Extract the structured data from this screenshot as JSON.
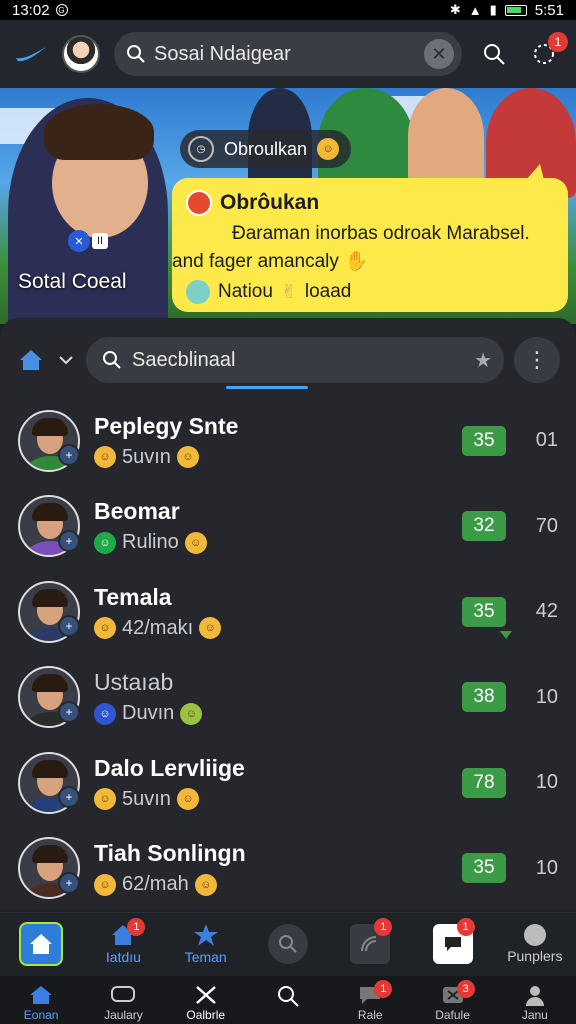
{
  "status_bar": {
    "time": "13:02",
    "battery": "5:51"
  },
  "top_bar": {
    "search_value": "Sosai Ndaigear"
  },
  "hero": {
    "caption": "Sotal Coeal",
    "chip_label": "Obroulkan",
    "badge_text": "II"
  },
  "popup": {
    "title": "Obrôukan",
    "body_line1": "Ðaraman inorbas odroak Marabsel.",
    "body_line2": "and fager amancaly",
    "footer": "Natiou",
    "footer_suffix": "loaad"
  },
  "panel": {
    "search_value": "Saecblinaal",
    "contacts": [
      {
        "name": "Peplegy Snte",
        "sub": "5uvın",
        "score": "35",
        "count": "01",
        "shirt": "#2f8a3a",
        "muted": false
      },
      {
        "name": "Beomar",
        "sub": "Rulino",
        "score": "32",
        "count": "70",
        "shirt": "#7b4fb8",
        "muted": false
      },
      {
        "name": "Temala",
        "sub": "42/makı",
        "score": "35",
        "count": "42",
        "shirt": "#2d3a66",
        "muted": false
      },
      {
        "name": "Ustaıab",
        "sub": "Duvın",
        "score": "38",
        "count": "10",
        "shirt": "#2b2b2b",
        "muted": true
      },
      {
        "name": "Dalo Lervliige",
        "sub": "5uvın",
        "score": "78",
        "count": "10",
        "shirt": "#22407a",
        "muted": false
      },
      {
        "name": "Tiah Sonlingn",
        "sub": "62/mah",
        "score": "35",
        "count": "10",
        "shirt": "#4a2c22",
        "muted": false
      }
    ]
  },
  "tabbar": {
    "tabs": [
      {
        "label": "",
        "badge": ""
      },
      {
        "label": "Iatdıu",
        "badge": "1"
      },
      {
        "label": "Teman",
        "badge": ""
      },
      {
        "label": "",
        "badge": ""
      },
      {
        "label": "",
        "badge": "1"
      },
      {
        "label": "",
        "badge": "1"
      },
      {
        "label": "Punplers",
        "badge": ""
      }
    ]
  },
  "navbar": {
    "items": [
      {
        "label": "Eonan",
        "badge": ""
      },
      {
        "label": "Jaulary",
        "badge": ""
      },
      {
        "label": "Oalbrle",
        "badge": ""
      },
      {
        "label": "",
        "badge": ""
      },
      {
        "label": "Rale",
        "badge": "1"
      },
      {
        "label": "Dafule",
        "badge": "3"
      },
      {
        "label": "Janu",
        "badge": ""
      }
    ]
  },
  "colors": {
    "accent": "#3ea6ff",
    "score_green": "#3c9b47",
    "popup_yellow": "#fde94a",
    "badge_red": "#e53935"
  }
}
